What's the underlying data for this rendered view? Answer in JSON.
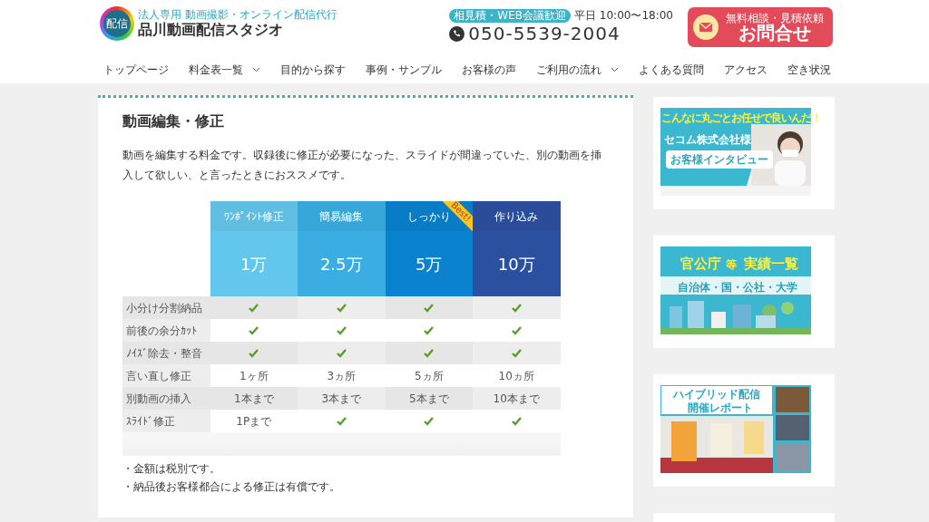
{
  "header": {
    "logo_mark": "配信",
    "tagline": "法人専用 動画撮影・オンライン配信代行",
    "site_name": "品川動画配信スタジオ",
    "contact_badge": "相見積・WEB会議歓迎",
    "hours": "平日 10:00〜18:00",
    "phone": "050-5539-2004",
    "cta_small": "無料相談・見積依頼",
    "cta_large": "お問合せ"
  },
  "nav": [
    {
      "label": "トップページ",
      "dropdown": false
    },
    {
      "label": "料金表一覧",
      "dropdown": true
    },
    {
      "label": "目的から探す",
      "dropdown": false
    },
    {
      "label": "事例・サンプル",
      "dropdown": false
    },
    {
      "label": "お客様の声",
      "dropdown": false
    },
    {
      "label": "ご利用の流れ",
      "dropdown": true
    },
    {
      "label": "よくある質問",
      "dropdown": false
    },
    {
      "label": "アクセス",
      "dropdown": false
    },
    {
      "label": "空き状況",
      "dropdown": false
    }
  ],
  "article": {
    "title": "動画編集・修正",
    "intro": "動画を編集する料金です。収録後に修正が必要になった、スライドが間違っていた、別の動画を挿入して欲しい、と言ったときにおススメです。",
    "plans": [
      {
        "name": "ﾜﾝﾎﾟｲﾝﾄ修正",
        "price": "1万",
        "color": "#63c6ec"
      },
      {
        "name": "簡易編集",
        "price": "2.5万",
        "color": "#3aaee2"
      },
      {
        "name": "しっかり",
        "price": "5万",
        "color": "#0a82cf",
        "ribbon": "Best!"
      },
      {
        "name": "作り込み",
        "price": "10万",
        "color": "#2c50a0"
      }
    ],
    "rows": [
      {
        "label": "小分け分割納品",
        "cells": [
          {
            "kind": "check"
          },
          {
            "kind": "check"
          },
          {
            "kind": "check"
          },
          {
            "kind": "check"
          }
        ]
      },
      {
        "label": "前後の余分ｶｯﾄ",
        "cells": [
          {
            "kind": "check"
          },
          {
            "kind": "check"
          },
          {
            "kind": "check"
          },
          {
            "kind": "check"
          }
        ]
      },
      {
        "label": "ﾉｲｽﾞ除去・整音",
        "cells": [
          {
            "kind": "check"
          },
          {
            "kind": "check"
          },
          {
            "kind": "check"
          },
          {
            "kind": "check"
          }
        ]
      },
      {
        "label": "言い直し修正",
        "cells": [
          {
            "kind": "text",
            "text": "1ヶ所"
          },
          {
            "kind": "text",
            "text": "3ヵ所"
          },
          {
            "kind": "text",
            "text": "5ヵ所"
          },
          {
            "kind": "text",
            "text": "10ヵ所"
          }
        ]
      },
      {
        "label": "別動画の挿入",
        "cells": [
          {
            "kind": "text",
            "text": "1本まで"
          },
          {
            "kind": "text",
            "text": "3本まで"
          },
          {
            "kind": "text",
            "text": "5本まで"
          },
          {
            "kind": "text",
            "text": "10本まで"
          }
        ]
      },
      {
        "label": "ｽﾗｲﾄﾞ修正",
        "cells": [
          {
            "kind": "text",
            "text": "1Pまで"
          },
          {
            "kind": "check"
          },
          {
            "kind": "check"
          },
          {
            "kind": "check"
          }
        ]
      }
    ],
    "notes": [
      "・金額は税別です。",
      "・納品後お客様都合による修正は有償です。"
    ]
  },
  "sidebar": [
    {
      "kind": "interview",
      "headline": "こんなに丸ごとお任せで良いんだ！",
      "title": "セコム株式会社様",
      "subtitle": "お客様インタビュー"
    },
    {
      "kind": "records",
      "title": "官公庁",
      "title_suffix": "等",
      "title_main": "実績一覧",
      "subtitle": "自治体・国・公社・大学"
    },
    {
      "kind": "report",
      "title": "ハイブリッド配信",
      "subtitle": "開催レポート"
    },
    {
      "kind": "blank"
    }
  ]
}
